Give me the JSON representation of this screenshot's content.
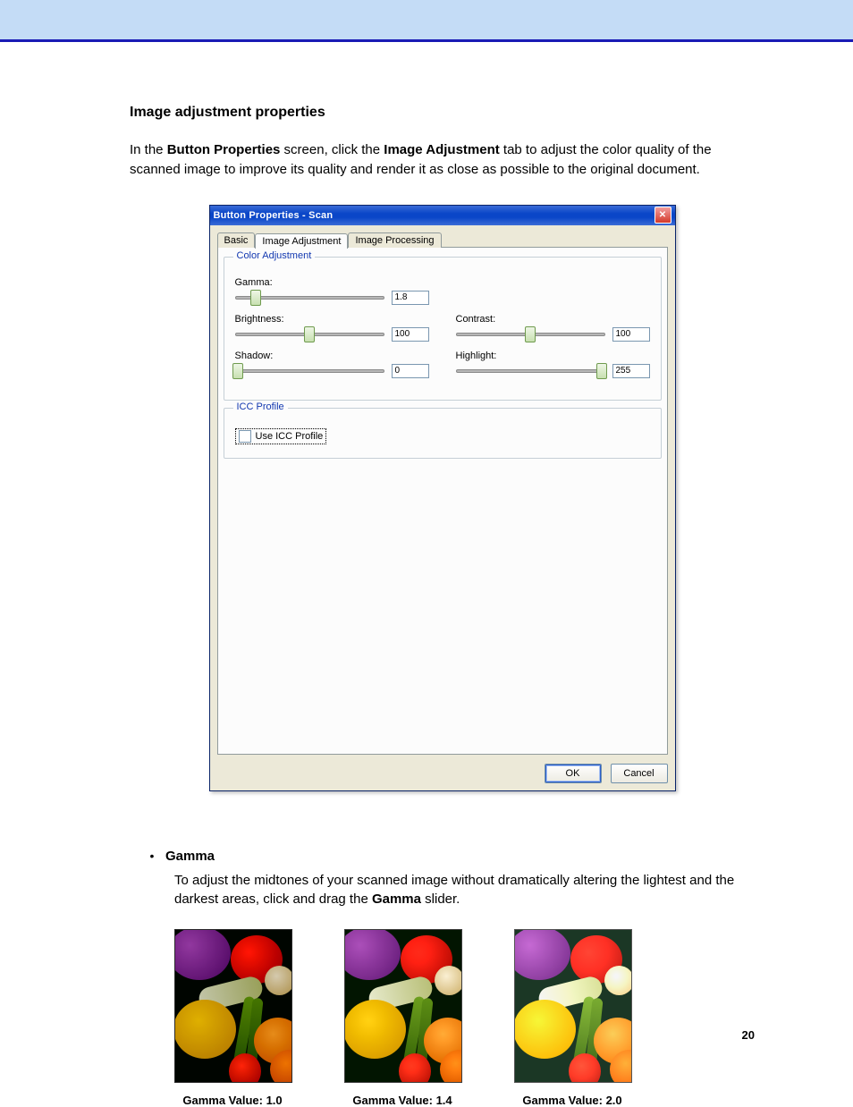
{
  "doc": {
    "page_number": "20",
    "heading": "Image adjustment properties",
    "intro_pre": "In the ",
    "intro_bold1": "Button Properties",
    "intro_mid1": " screen, click the ",
    "intro_bold2": "Image Adjustment",
    "intro_post": " tab to adjust the color quality of the scanned image to improve its quality and render it as close as possible to the original document."
  },
  "window": {
    "title": "Button Properties - Scan",
    "close_glyph": "✕",
    "tabs": {
      "basic": "Basic",
      "image_adjustment": "Image Adjustment",
      "image_processing": "Image Processing"
    },
    "groups": {
      "color_adjustment": "Color Adjustment",
      "icc_profile": "ICC Profile"
    },
    "labels": {
      "gamma": "Gamma:",
      "brightness": "Brightness:",
      "contrast": "Contrast:",
      "shadow": "Shadow:",
      "highlight": "Highlight:"
    },
    "values": {
      "gamma": "1.8",
      "brightness": "100",
      "contrast": "100",
      "shadow": "0",
      "highlight": "255"
    },
    "slider_pos": {
      "gamma": "14%",
      "brightness": "50%",
      "contrast": "50%",
      "shadow": "2%",
      "highlight": "98%"
    },
    "icc_checkbox_label": "Use ICC Profile",
    "buttons": {
      "ok": "OK",
      "cancel": "Cancel"
    }
  },
  "gamma_section": {
    "label": "Gamma",
    "body_pre": "To adjust the midtones of your scanned image without dramatically altering the lightest and the darkest areas, click and drag the ",
    "body_bold": "Gamma",
    "body_post": " slider.",
    "examples": [
      {
        "caption": "Gamma Value: 1.0",
        "gamma": "1.0"
      },
      {
        "caption": "Gamma Value: 1.4",
        "gamma": "1.4"
      },
      {
        "caption": "Gamma Value: 2.0",
        "gamma": "2.0"
      }
    ]
  }
}
